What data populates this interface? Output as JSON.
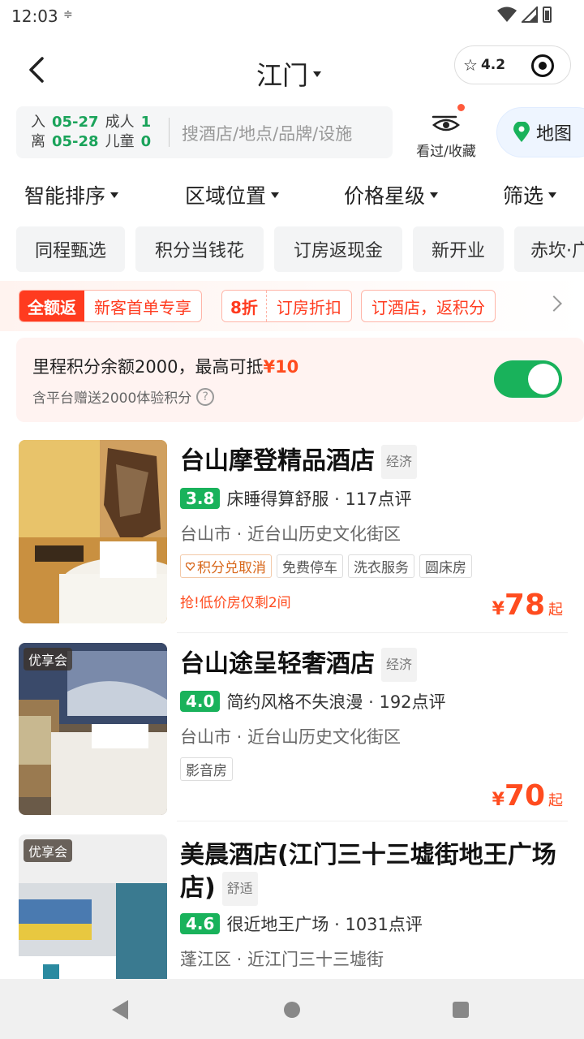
{
  "status": {
    "time": "12:03",
    "extra_icon": "≑"
  },
  "nav": {
    "city": "江门",
    "rating": "4.2"
  },
  "search": {
    "checkin_label": "入",
    "checkin_date": "05-27",
    "adults_label": "成人",
    "adults": "1",
    "checkout_label": "离",
    "checkout_date": "05-28",
    "children_label": "儿童",
    "children": "0",
    "placeholder": "搜酒店/地点/品牌/设施"
  },
  "fav_label": "看过/收藏",
  "map_label": "地图",
  "sort": [
    "智能排序",
    "区域位置",
    "价格星级",
    "筛选"
  ],
  "chips": [
    "同程甄选",
    "积分当钱花",
    "订房返现金",
    "新开业",
    "赤坎·广"
  ],
  "promo": {
    "g1_badge": "全额返",
    "g1_text": "新客首单专享",
    "g2_badge": "8折",
    "g2_text": "订房折扣",
    "g3_text": "订酒店，返积分"
  },
  "points": {
    "main_prefix": "里程积分余额2000，最高可抵",
    "main_money": "¥10",
    "sub": "含平台赠送2000体验积分",
    "help": "?",
    "enabled": true
  },
  "hotels": [
    {
      "name": "台山摩登精品酒店",
      "level": "经济",
      "score": "3.8",
      "review": "床睡得算舒服 · 117点评",
      "location": "台山市 · 近台山历史文化街区",
      "tags": [
        "积分兑取消",
        "免费停车",
        "洗衣服务",
        "圆床房"
      ],
      "urgent": "抢!低价房仅剩2间",
      "yen": "¥",
      "price": "78",
      "qi": "起"
    },
    {
      "vip": "优享会",
      "name": "台山途呈轻奢酒店",
      "level": "经济",
      "score": "4.0",
      "review": "简约风格不失浪漫 · 192点评",
      "location": "台山市 · 近台山历史文化街区",
      "tags": [
        "影音房"
      ],
      "yen": "¥",
      "price": "70",
      "qi": "起"
    },
    {
      "vip": "优享会",
      "name_line1": "美晨酒店(江门三十三墟街地王广场",
      "name_line2": "店)",
      "level": "舒适",
      "score": "4.6",
      "review": "很近地王广场 · 1031点评",
      "location": "蓬江区 · 近江门三十三墟街"
    }
  ]
}
